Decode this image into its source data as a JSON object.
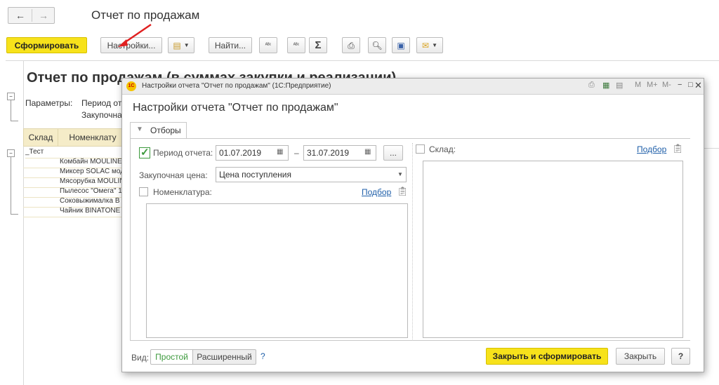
{
  "page": {
    "title": "Отчет по продажам",
    "nav": {
      "back_icon": "arrow-left-icon",
      "forward_icon": "arrow-right-icon"
    }
  },
  "toolbar": {
    "generate_label": "Сформировать",
    "settings_label": "Настройки...",
    "find_label": "Найти...",
    "sum_icon": "Σ",
    "variant_icon": "report-variant-icon",
    "print_icon": "printer-icon",
    "preview_icon": "preview-icon",
    "save_icon": "save-icon",
    "mail_icon": "envelope-icon"
  },
  "report": {
    "title": "Отчет по продажам (в суммах закупки и реализации)",
    "params_label": "Параметры:",
    "param_period": "Период отч",
    "param_price": "Закупочная",
    "columns": [
      "Склад",
      "Номенклату"
    ],
    "group_row": "_Тест",
    "rows": [
      "Комбайн MOULINE",
      "Миксер SOLAC мод",
      "Мясорубка MOULIN",
      "Пылесос \"Омега\" 1",
      "Соковыжималка  В",
      "Чайник BINATONE"
    ]
  },
  "dialog": {
    "window_title": "Настройки отчета \"Отчет по продажам\" (1С:Предприятие)",
    "heading": "Настройки отчета \"Отчет по продажам\"",
    "tab_label": "Отборы",
    "period_label": "Период отчета:",
    "period_checked": true,
    "date_from": "01.07.2019",
    "date_sep": "–",
    "date_to": "31.07.2019",
    "more_label": "...",
    "price_label": "Закупочная цена:",
    "price_value": "Цена поступления",
    "nomenclature_label": "Номенклатура:",
    "nomenclature_checked": false,
    "warehouse_label": "Склад:",
    "warehouse_checked": false,
    "pick_link": "Подбор",
    "view_label": "Вид:",
    "view_simple": "Простой",
    "view_extended": "Расширенный",
    "help_q": "?",
    "close_generate": "Закрыть и сформировать",
    "close": "Закрыть",
    "help_button": "?",
    "titlebar_icons": [
      "M",
      "M+",
      "M-"
    ]
  },
  "colors": {
    "accent_yellow": "#f7e21b",
    "link_blue": "#1f5fa9",
    "check_green": "#3d9a3d",
    "arrow_red": "#e02020",
    "table_header": "#f5ecc8"
  }
}
